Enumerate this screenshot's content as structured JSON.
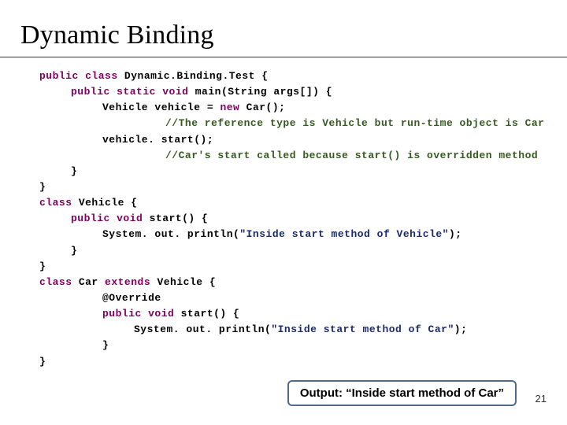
{
  "title": "Dynamic Binding",
  "code": {
    "l1a": "public",
    "l1b": " class",
    "l1c": " Dynamic.Binding.Test {",
    "l2a": "public",
    "l2b": " static void",
    "l2c": " main(String args[]) {",
    "l3": "Vehicle vehicle = ",
    "l3b": "new",
    "l3c": " Car();",
    "l4": "//The reference type is Vehicle but run-time object is Car",
    "l5": "vehicle. start();",
    "l6": "//Car's start called because start() is overridden method",
    "l7": "}",
    "l8": "}",
    "l9a": "class",
    "l9b": " Vehicle {",
    "l10a": "public void",
    "l10b": " start() {",
    "l11a": "System. out. println(",
    "l11b": "\"Inside start method of Vehicle\"",
    "l11c": ");",
    "l12": "}",
    "l13": "}",
    "l14a": "class",
    "l14b": " Car ",
    "l14c": "extends",
    "l14d": " Vehicle {",
    "l15": "@Override",
    "l16a": "public void",
    "l16b": " start() {",
    "l17a": "System. out. println(",
    "l17b": "\"Inside start method of Car\"",
    "l17c": ");",
    "l18": "}",
    "l19": "}"
  },
  "output_box": "Output: “Inside start method of Car”",
  "slide_number": "21"
}
